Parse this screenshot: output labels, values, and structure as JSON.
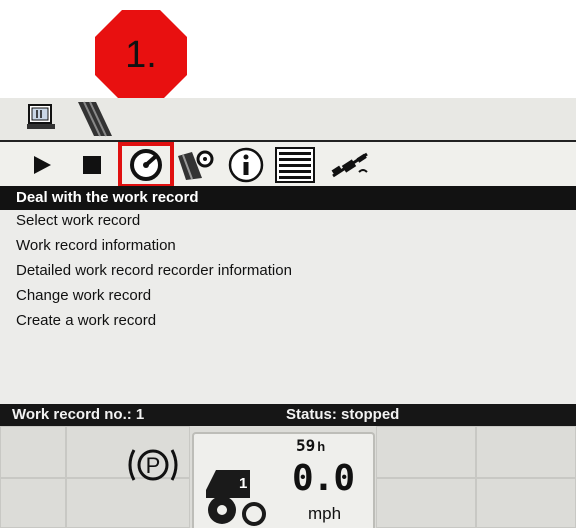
{
  "callout": {
    "label": "1.",
    "color": "#e81010"
  },
  "topbar": {
    "icons": [
      "terminal-icon",
      "field-map-icon"
    ]
  },
  "toolbar": {
    "icons": [
      "play-icon",
      "stop-icon",
      "work-record-counter-icon",
      "field-settings-icon",
      "info-icon",
      "list-icon",
      "gps-satellite-icon"
    ],
    "selected": "work-record-counter-icon",
    "highlight_color": "#e01010"
  },
  "menu": {
    "header": "Deal with the work record",
    "items": [
      "Select work record",
      "Work record information",
      "Detailed work record recorder information",
      "Change work record",
      "Create a work record"
    ]
  },
  "status": {
    "record": "Work record no.: 1",
    "state": "Status: stopped"
  },
  "dashboard": {
    "park_label": "P",
    "hours_value": "59",
    "hours_unit": "h",
    "speed_value": "0.0",
    "speed_unit": "mph",
    "gear_badge": "1"
  }
}
